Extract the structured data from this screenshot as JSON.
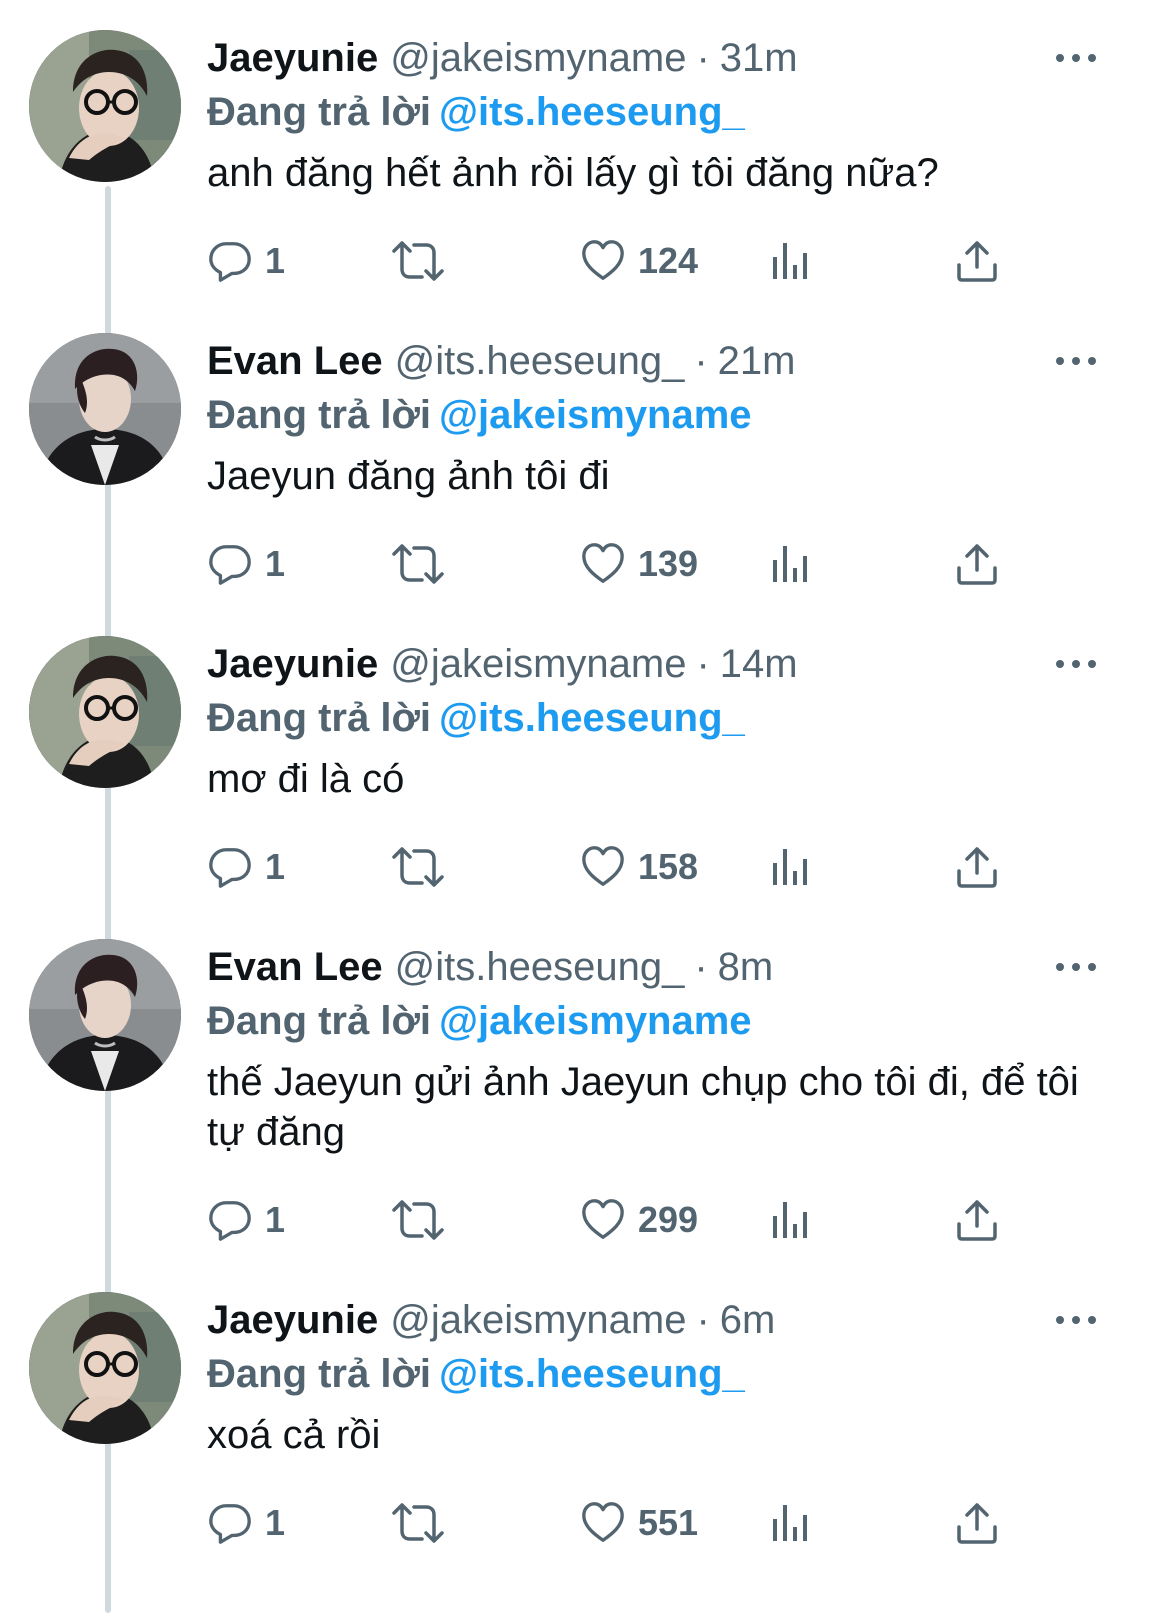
{
  "reply_prefix": "Đang trả lời",
  "tweets": [
    {
      "name": "Jaeyunie",
      "handle": "@jakeismyname",
      "separator": "·",
      "time": "31m",
      "reply_to": "@its.heeseung_",
      "text": "anh đăng hết ảnh rồi lấy gì tôi đăng nữa?",
      "replies": "1",
      "likes": "124"
    },
    {
      "name": "Evan Lee",
      "handle": "@its.heeseung_",
      "separator": "·",
      "time": "21m",
      "reply_to": "@jakeismyname",
      "text": "Jaeyun đăng ảnh tôi đi",
      "replies": "1",
      "likes": "139"
    },
    {
      "name": "Jaeyunie",
      "handle": "@jakeismyname",
      "separator": "·",
      "time": "14m",
      "reply_to": "@its.heeseung_",
      "text": "mơ đi là có",
      "replies": "1",
      "likes": "158"
    },
    {
      "name": "Evan Lee",
      "handle": "@its.heeseung_",
      "separator": "·",
      "time": "8m",
      "reply_to": "@jakeismyname",
      "text": "thế Jaeyun gửi ảnh Jaeyun chụp cho tôi đi, để tôi tự đăng",
      "replies": "1",
      "likes": "299"
    },
    {
      "name": "Jaeyunie",
      "handle": "@jakeismyname",
      "separator": "·",
      "time": "6m",
      "reply_to": "@its.heeseung_",
      "text": "xoá cả rồi",
      "replies": "1",
      "likes": "551"
    }
  ],
  "colors": {
    "text": "#0f1419",
    "secondary": "#536471",
    "mention": "#1d9bf0",
    "thread_line": "#cfd9de"
  },
  "icons": {
    "reply": "speech-bubble-icon",
    "retweet": "retweet-arrows-icon",
    "like": "heart-outline-icon",
    "views": "bar-chart-icon",
    "share": "share-upload-icon",
    "more": "ellipsis-icon"
  }
}
